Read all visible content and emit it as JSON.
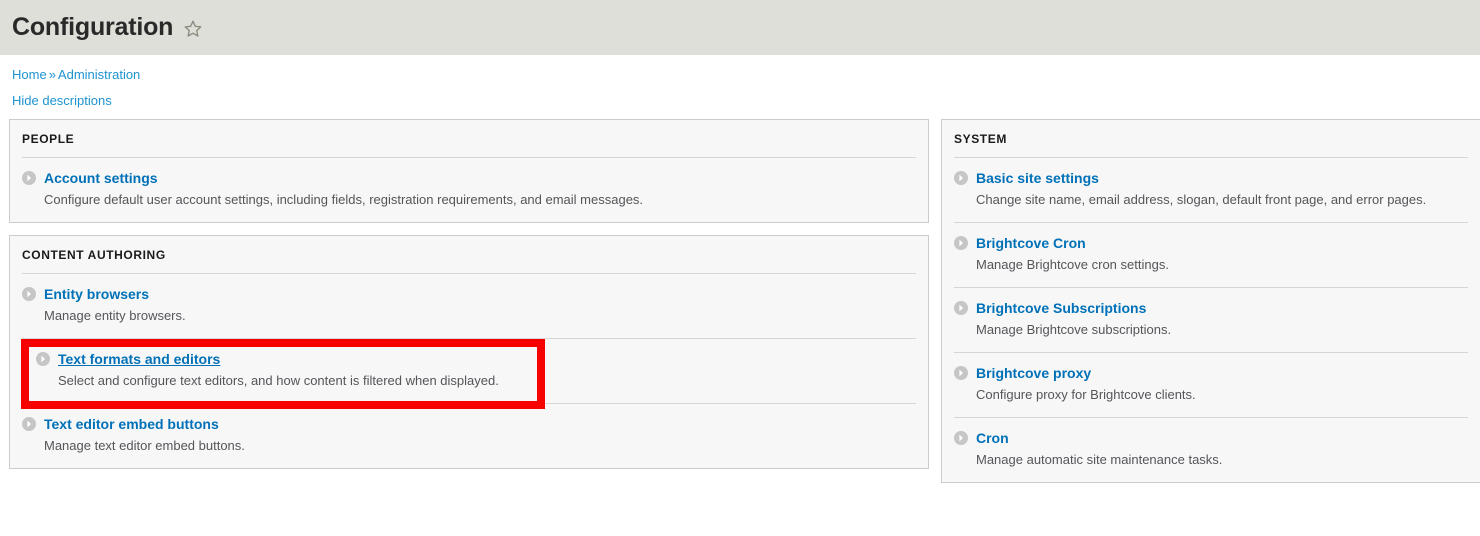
{
  "header": {
    "title": "Configuration",
    "star_icon": "star-outline-icon"
  },
  "breadcrumb": {
    "home": "Home",
    "separator": "»",
    "current": "Administration"
  },
  "toggle": {
    "hide_descriptions": "Hide descriptions"
  },
  "colors": {
    "header_bg": "#dfdfd9",
    "panel_bg": "#f7f7f7",
    "panel_border": "#cccccc",
    "link_blue": "#0071b8",
    "breadcrumb_blue": "#1e93d1",
    "highlight_red": "#f60000",
    "description_text": "#55555a"
  },
  "left_column": [
    {
      "title": "PEOPLE",
      "items": [
        {
          "icon": "chevron-right-circle-icon",
          "label": "Account settings",
          "description": "Configure default user account settings, including fields, registration requirements, and email messages.",
          "highlighted": false,
          "hovered": false
        }
      ]
    },
    {
      "title": "CONTENT AUTHORING",
      "items": [
        {
          "icon": "chevron-right-circle-icon",
          "label": "Entity browsers",
          "description": "Manage entity browsers.",
          "highlighted": false,
          "hovered": false
        },
        {
          "icon": "chevron-right-circle-icon",
          "label": "Text formats and editors",
          "description": "Select and configure text editors, and how content is filtered when displayed.",
          "highlighted": true,
          "hovered": true
        },
        {
          "icon": "chevron-right-circle-icon",
          "label": "Text editor embed buttons",
          "description": "Manage text editor embed buttons.",
          "highlighted": false,
          "hovered": false
        }
      ]
    }
  ],
  "right_column": [
    {
      "title": "SYSTEM",
      "items": [
        {
          "icon": "chevron-right-circle-icon",
          "label": "Basic site settings",
          "description": "Change site name, email address, slogan, default front page, and error pages.",
          "highlighted": false,
          "hovered": false
        },
        {
          "icon": "chevron-right-circle-icon",
          "label": "Brightcove Cron",
          "description": "Manage Brightcove cron settings.",
          "highlighted": false,
          "hovered": false
        },
        {
          "icon": "chevron-right-circle-icon",
          "label": "Brightcove Subscriptions",
          "description": "Manage Brightcove subscriptions.",
          "highlighted": false,
          "hovered": false
        },
        {
          "icon": "chevron-right-circle-icon",
          "label": "Brightcove proxy",
          "description": "Configure proxy for Brightcove clients.",
          "highlighted": false,
          "hovered": false
        },
        {
          "icon": "chevron-right-circle-icon",
          "label": "Cron",
          "description": "Manage automatic site maintenance tasks.",
          "highlighted": false,
          "hovered": false
        }
      ]
    }
  ]
}
